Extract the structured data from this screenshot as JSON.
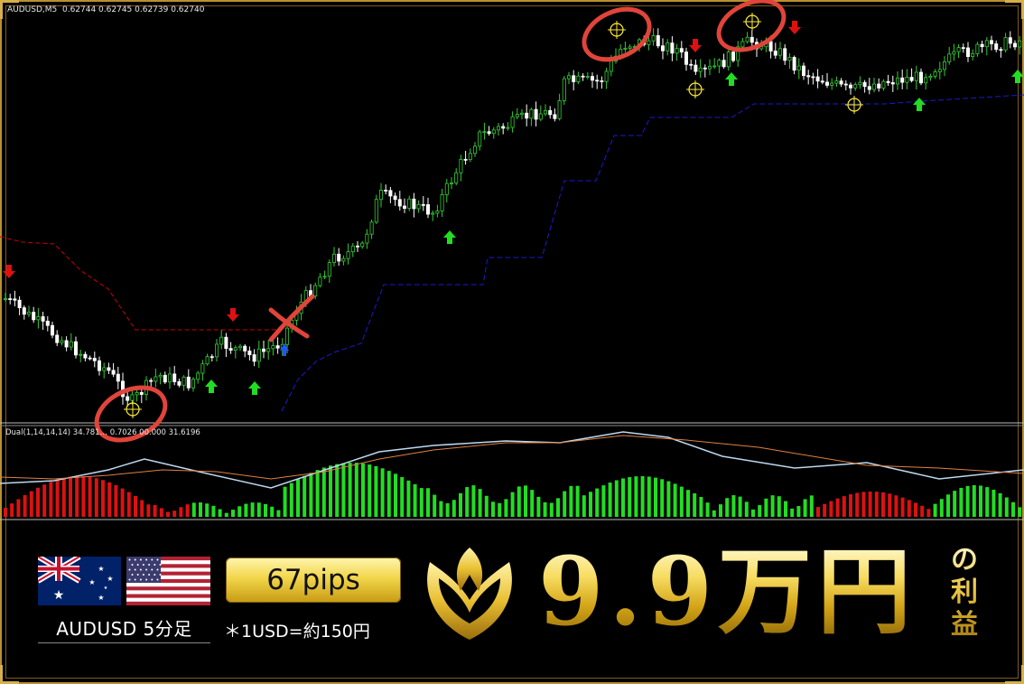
{
  "chart": {
    "symbol_header": "AUDUSD,M5  0.62744 0.62745 0.62739 0.62740",
    "indicator_header": "Dual(1,14,14,14) 34.781… 0.7026 00.000 31.6196",
    "colors": {
      "background": "#000000",
      "bull_candle": "#33cc33",
      "bear_candle": "#ffffff",
      "resistance_line": "#cc0000",
      "support_line": "#1a1acc",
      "buy_arrow": "#22dd22",
      "sell_arrow": "#dd1111",
      "osc_bull": "#22dd22",
      "osc_bear": "#dd1111",
      "osc_line_1": "#bcd8f0",
      "osc_line_2": "#e08040",
      "highlight_circle": "#e0443a",
      "target_marker": "#ffee33"
    }
  },
  "banner": {
    "pair_label": "AUDUSD 5分足",
    "pips_label": "67pips",
    "rate_note": "＊1USD=約150円",
    "profit_amount": "9.9万円",
    "profit_suffix_1": "の",
    "profit_suffix_2": "利",
    "profit_suffix_3": "益",
    "colors": {
      "gold": "#f2d64a",
      "frame": "#b8902f"
    }
  }
}
